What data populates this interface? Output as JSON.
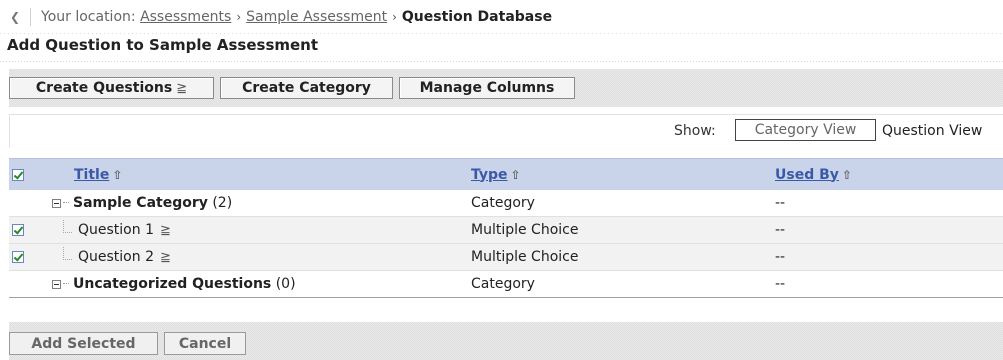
{
  "breadcrumb": {
    "back_icon": "chevron-left-icon",
    "prefix": "Your location:",
    "items": [
      {
        "label": "Assessments"
      },
      {
        "label": "Sample Assessment"
      }
    ],
    "current": "Question Database"
  },
  "page": {
    "heading": "Add Question to Sample Assessment"
  },
  "toolbar": {
    "create_questions": "Create Questions",
    "create_questions_icon": "menu-stack-icon",
    "create_category": "Create Category",
    "manage_columns": "Manage Columns"
  },
  "view": {
    "show_label": "Show:",
    "category_view": "Category View",
    "question_view": "Question View"
  },
  "table": {
    "columns": {
      "title": "Title",
      "type": "Type",
      "used_by": "Used By"
    },
    "rows": [
      {
        "title": "Sample Category",
        "count": "(2)",
        "type": "Category",
        "used_by": "--",
        "kind": "category"
      },
      {
        "title": "Question 1",
        "type": "Multiple Choice",
        "used_by": "--",
        "kind": "question",
        "checked": true
      },
      {
        "title": "Question 2",
        "type": "Multiple Choice",
        "used_by": "--",
        "kind": "question",
        "checked": true
      },
      {
        "title": "Uncategorized Questions",
        "count": "(0)",
        "type": "Category",
        "used_by": "--",
        "kind": "category"
      }
    ]
  },
  "actions": {
    "add_selected": "Add Selected",
    "cancel": "Cancel"
  }
}
